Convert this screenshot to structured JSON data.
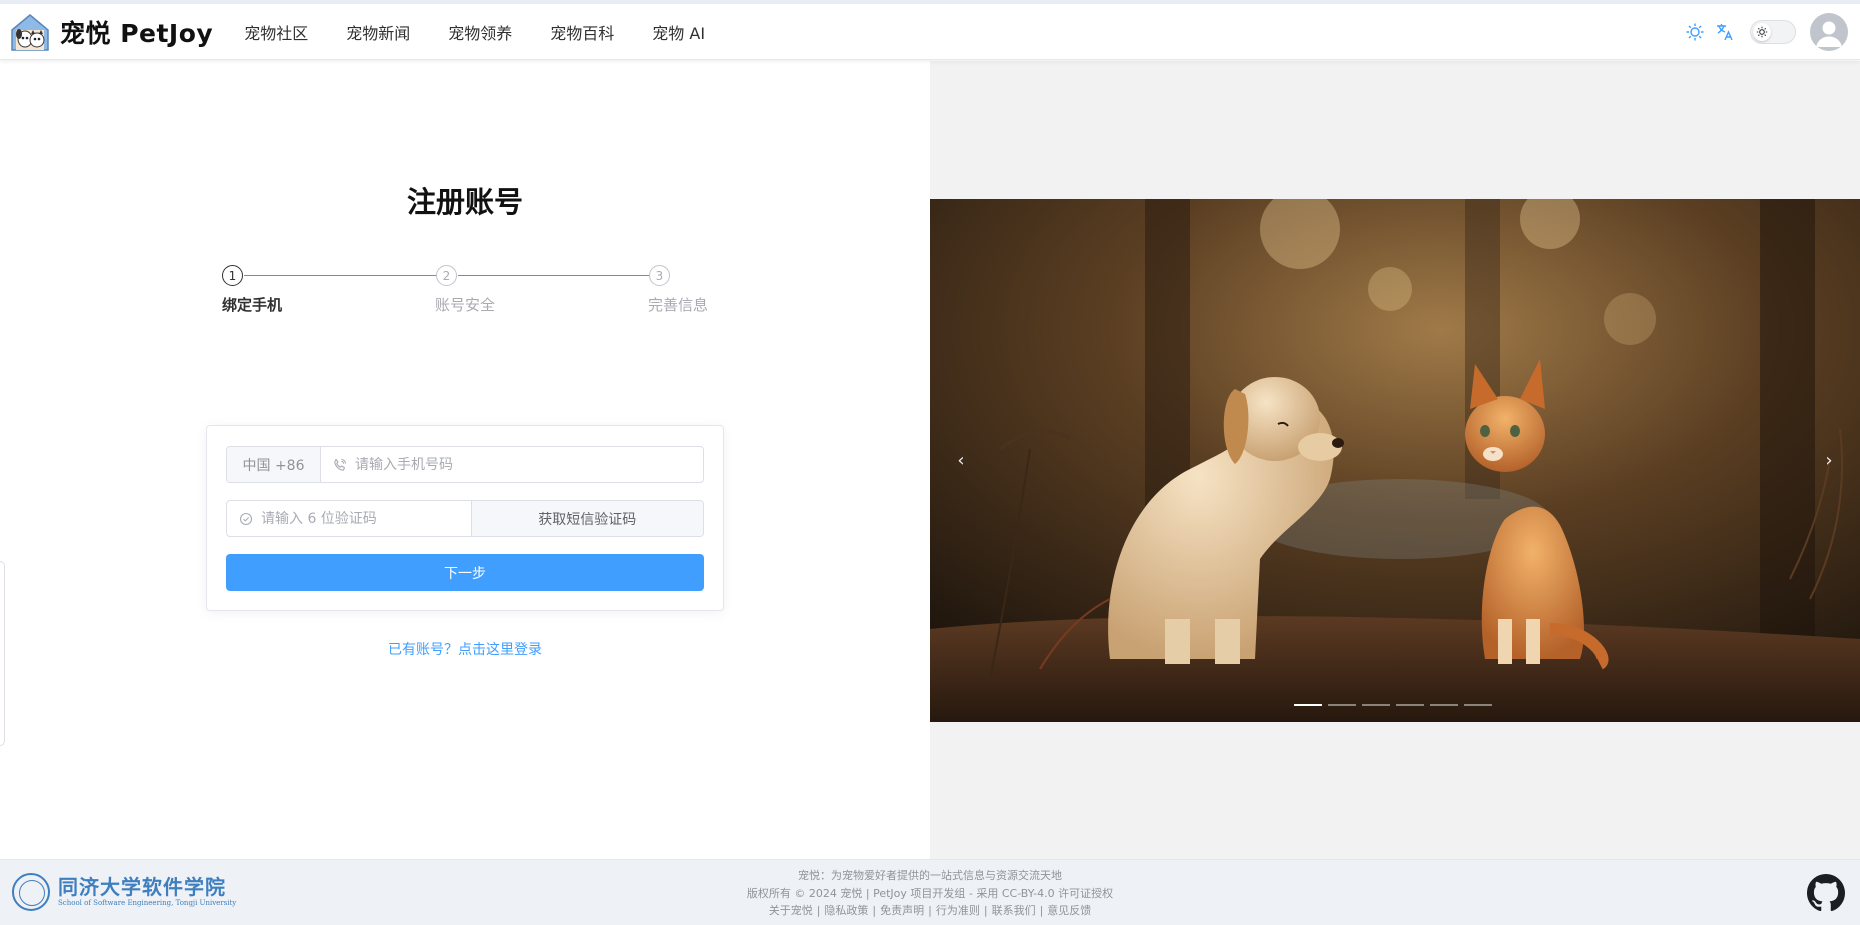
{
  "header": {
    "brand": "宠悦 PetJoy",
    "nav": [
      "宠物社区",
      "宠物新闻",
      "宠物领养",
      "宠物百科",
      "宠物 AI"
    ]
  },
  "register": {
    "title": "注册账号",
    "steps": [
      {
        "num": "1",
        "label": "绑定手机"
      },
      {
        "num": "2",
        "label": "账号安全"
      },
      {
        "num": "3",
        "label": "完善信息"
      }
    ],
    "active_step": 1,
    "phone_prefix": "中国 +86",
    "phone_placeholder": "请输入手机号码",
    "code_placeholder": "请输入 6 位验证码",
    "code_button": "获取短信验证码",
    "next_button": "下一步",
    "login_link": "已有账号？点击这里登录"
  },
  "carousel": {
    "prev": "‹",
    "next": "›",
    "indicator_count": 6,
    "active_indicator": 0
  },
  "footer": {
    "uni_cn": "同济大学软件学院",
    "uni_en": "School of Software Engineering, Tongji University",
    "line1": "宠悦：为宠物爱好者提供的一站式信息与资源交流天地",
    "line2": "版权所有 © 2024 宠悦 | PetJoy 项目开发组 - 采用 CC-BY-4.0 许可证授权",
    "links": [
      "关于宠悦",
      "隐私政策",
      "免责声明",
      "行为准则",
      "联系我们",
      "意见反馈"
    ]
  },
  "colors": {
    "primary": "#409eff",
    "uni_blue": "#3f7fbf"
  }
}
